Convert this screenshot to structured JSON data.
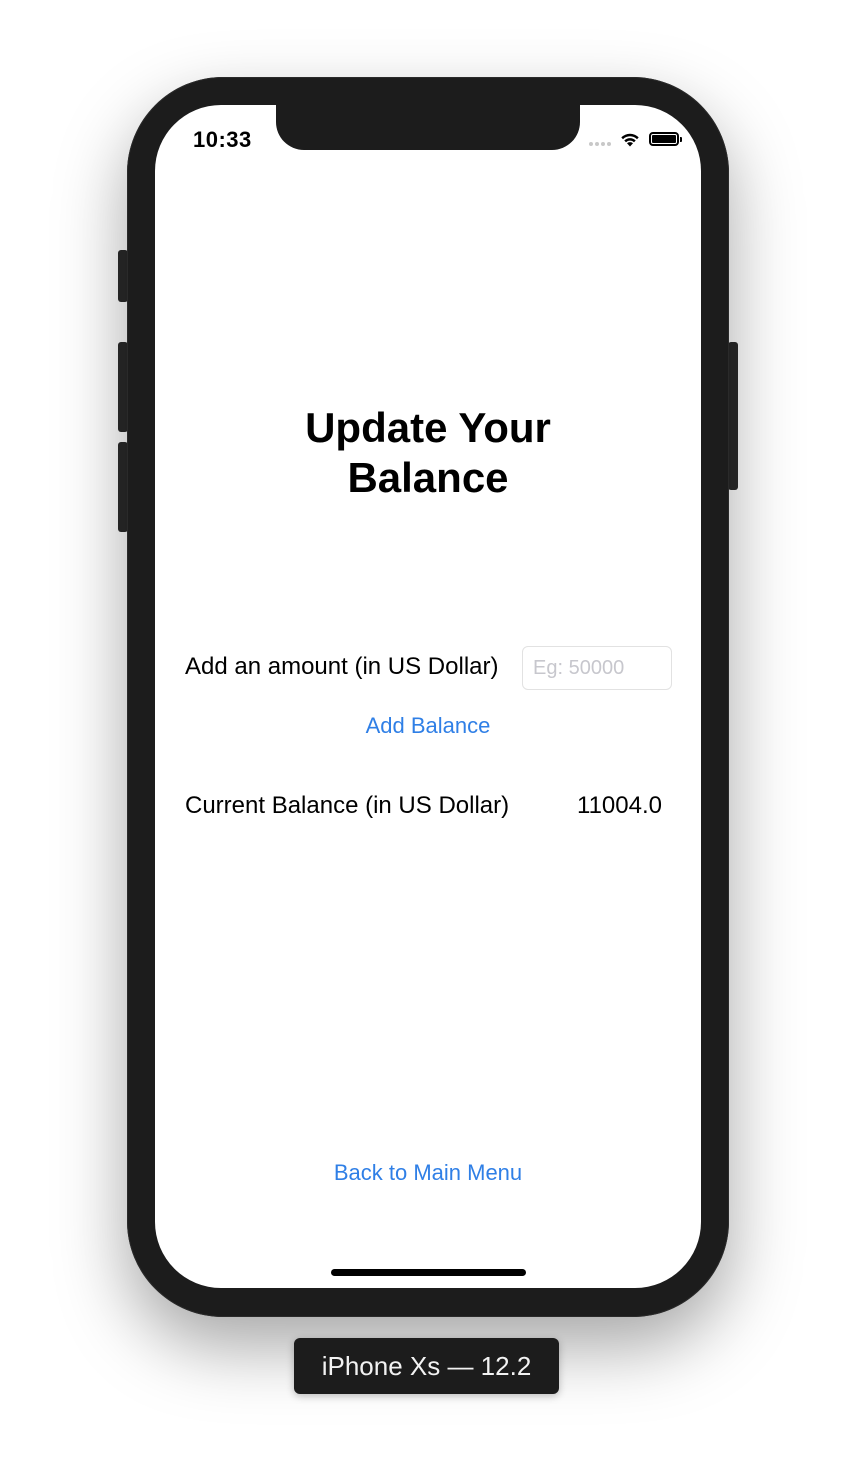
{
  "status_bar": {
    "time": "10:33",
    "icons": [
      "signal-icon",
      "wifi-icon",
      "battery-icon"
    ]
  },
  "main": {
    "title_line1": "Update Your",
    "title_line2": "Balance",
    "amount_label": "Add an amount (in US Dollar)",
    "amount_input": {
      "value": "",
      "placeholder": "Eg: 50000"
    },
    "add_button_label": "Add Balance",
    "balance_label": "Current Balance (in US Dollar)",
    "balance_value": "11004.0",
    "back_button_label": "Back to Main Menu"
  },
  "device_label": "iPhone Xs — 12.2",
  "colors": {
    "link": "#2f7fe6",
    "device_frame": "#1c1c1c"
  }
}
